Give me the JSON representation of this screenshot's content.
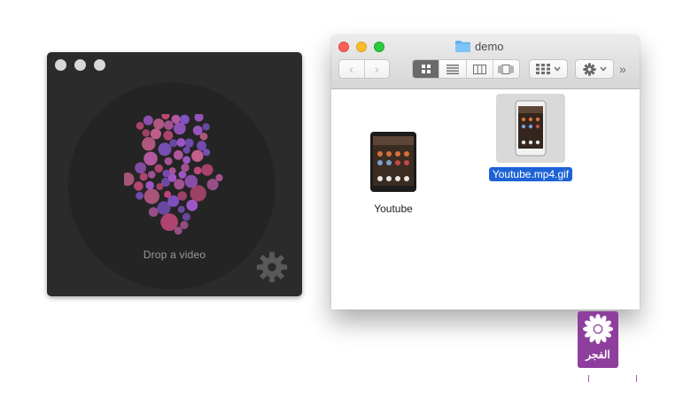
{
  "app": {
    "drop_label": "Drop a video",
    "settings_icon": "gear-icon",
    "arrow_colors": [
      "#b85aa3",
      "#9f58c8",
      "#c4497c",
      "#7e52c1",
      "#d06493"
    ]
  },
  "finder": {
    "title": "demo",
    "toolbar": {
      "back_icon": "‹",
      "forward_icon": "›",
      "more_icon": "»"
    },
    "files": [
      {
        "name": "Youtube",
        "selected": false
      },
      {
        "name": "Youtube.mp4.gif",
        "selected": true
      }
    ]
  },
  "logo": {
    "text": "الفجر",
    "color": "#8e3f9e"
  }
}
